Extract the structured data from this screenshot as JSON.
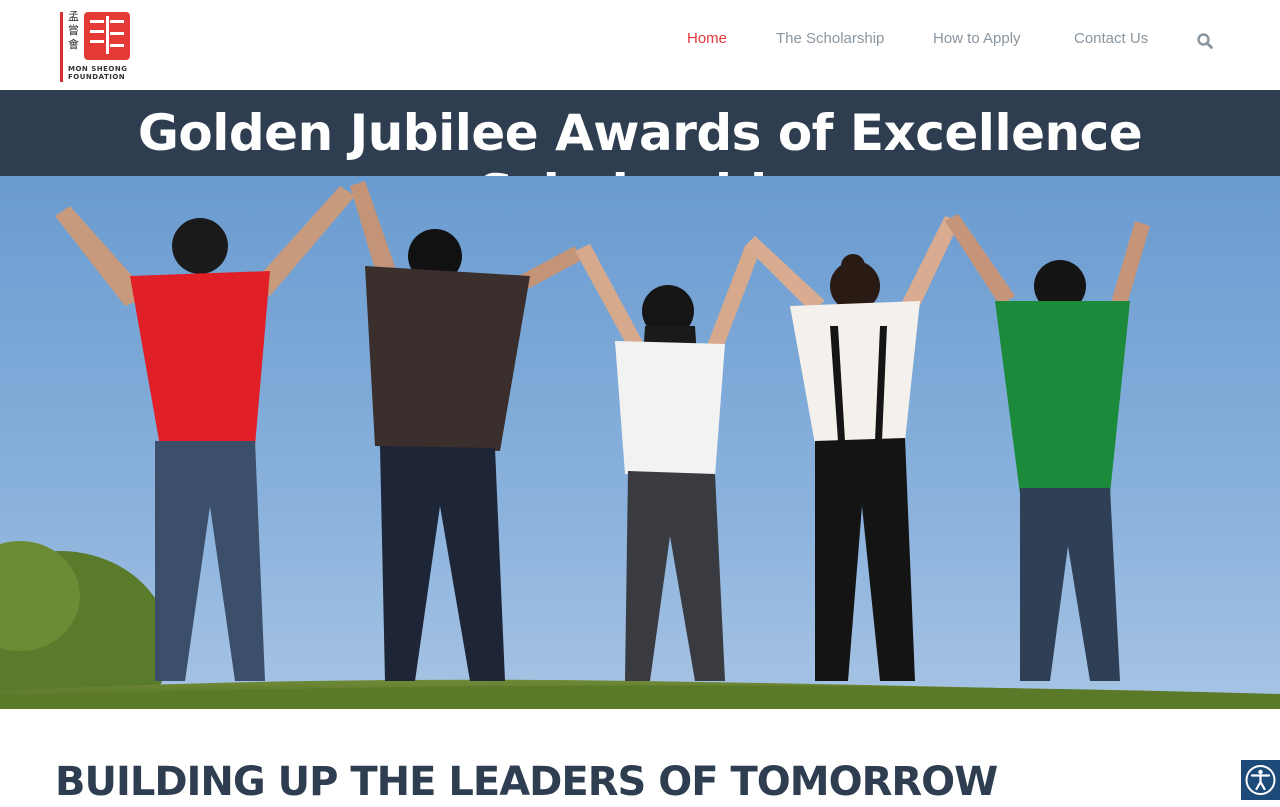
{
  "logo": {
    "cjk_text": "孟嘗會",
    "name_line1": "MON SHEONG",
    "name_line2": "FOUNDATION",
    "icon": "seal-logo-icon",
    "accent": "#e53935"
  },
  "nav": {
    "items": [
      {
        "label": "Home",
        "active": true
      },
      {
        "label": "The Scholarship",
        "active": false
      },
      {
        "label": "How to Apply",
        "active": false
      },
      {
        "label": "Contact Us",
        "active": false
      }
    ],
    "search_icon": "search-icon",
    "active_color": "#e03a3e",
    "inactive_color": "#8a96a0"
  },
  "banner": {
    "title": "Golden Jubilee Awards of Excellence Scholarship",
    "background": "#2e3e50"
  },
  "hero": {
    "image": "five-people-raising-joined-hands-photo"
  },
  "main": {
    "heading": "BUILDING UP THE LEADERS OF TOMORROW"
  },
  "accessibility_button": {
    "icon": "accessibility-icon",
    "background": "#1e4a7a"
  }
}
